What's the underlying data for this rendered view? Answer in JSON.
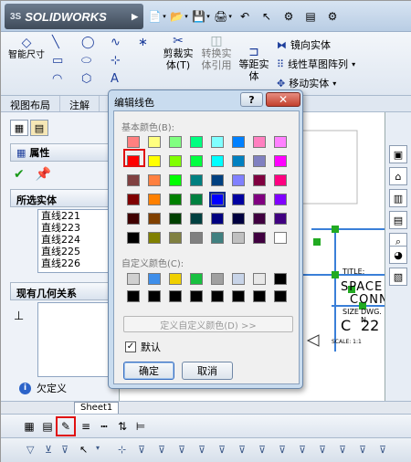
{
  "app": {
    "logo_text": "SOLIDWORKS",
    "logo_prefix": "3S"
  },
  "ribbon": {
    "smart_dimension": "智能尺寸",
    "smart_dimension_line2": "寸",
    "trim": "剪裁实体(T)",
    "trim_line1": "剪裁实",
    "trim_line2": "体(T)",
    "convert": "转换实体引用",
    "convert_line1": "转换实",
    "convert_line2": "体引用",
    "offset": "等距实体",
    "offset_line1": "等距实",
    "offset_line2": "体",
    "mirror": "镜向实体",
    "linear_pattern": "线性草图阵列",
    "move": "移动实体"
  },
  "tabs": [
    "视图布局",
    "注解",
    "草"
  ],
  "left_panel": {
    "properties_title": "属性",
    "selected_entities_title": "所选实体",
    "selected_entities": [
      "直线221",
      "直线223",
      "直线224",
      "直线225",
      "直线226"
    ],
    "existing_relations_title": "现有几何关系",
    "status": "欠定义"
  },
  "sheet_tab": "Sheet1",
  "dialog": {
    "title": "编辑线色",
    "help": "?",
    "close": "✕",
    "basic_colors_label": "基本颜色(B):",
    "custom_colors_label": "自定义颜色(C):",
    "define_custom_button": "定义自定义颜色(D) >>",
    "default_checkbox": "默认",
    "default_checked": true,
    "ok_button": "确定",
    "cancel_button": "取消",
    "basic_colors": [
      [
        "#ff8080",
        "#ffff80",
        "#80ff80",
        "#00ff80",
        "#80ffff",
        "#0080ff",
        "#ff80c0",
        "#ff80ff"
      ],
      [
        "#ff0000",
        "#ffff00",
        "#80ff00",
        "#00ff40",
        "#00ffff",
        "#0080c0",
        "#8080c0",
        "#ff00ff"
      ],
      [
        "#804040",
        "#ff8040",
        "#00ff00",
        "#008080",
        "#004080",
        "#8080ff",
        "#800040",
        "#ff0080"
      ],
      [
        "#800000",
        "#ff8000",
        "#008000",
        "#008040",
        "#0000ff",
        "#0000a0",
        "#800080",
        "#8000ff"
      ],
      [
        "#400000",
        "#804000",
        "#004000",
        "#004040",
        "#000080",
        "#000040",
        "#400040",
        "#400080"
      ],
      [
        "#000000",
        "#808000",
        "#808040",
        "#808080",
        "#408080",
        "#c0c0c0",
        "#400040",
        "#ffffff"
      ]
    ],
    "selected_basic": [
      1,
      0
    ],
    "selected_basic_blue": [
      3,
      4
    ],
    "custom_colors": [
      [
        "#d0d0d0",
        "#3e8eea",
        "#f0d000",
        "#18c040",
        "#a0a0a0",
        "#c8d4e8",
        "#e8e8e8",
        "#000000"
      ],
      [
        "#000000",
        "#000000",
        "#000000",
        "#000000",
        "#000000",
        "#000000",
        "#000000",
        "#000000"
      ]
    ]
  },
  "drawing": {
    "title_label": "TITLE:",
    "title_text1": "SPACE",
    "title_text2": "CONN",
    "size_label": "SIZE",
    "dwg_label": "DWG. N",
    "size_value": "C",
    "dwg_value": "22",
    "scale_text": "SCALE: 1:1"
  }
}
